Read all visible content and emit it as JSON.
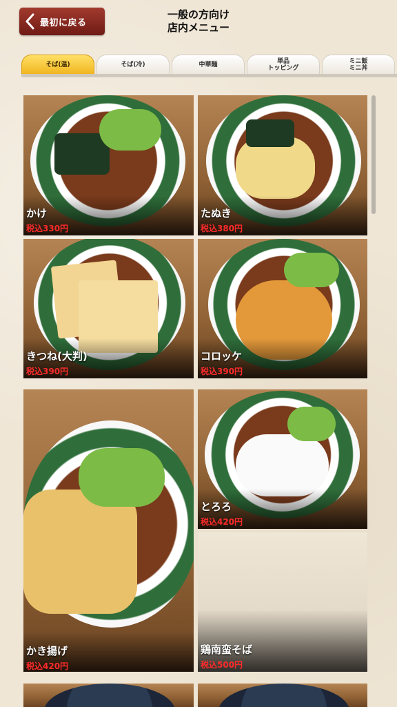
{
  "header": {
    "back_label": "最初に戻る",
    "title_line1": "一般の方向け",
    "title_line2": "店内メニュー"
  },
  "tabs": [
    {
      "label": "そば(温)",
      "active": true
    },
    {
      "label": "そば(冷)",
      "active": false
    },
    {
      "label": "中華麺",
      "active": false
    },
    {
      "label": "単品\nトッピング",
      "active": false
    },
    {
      "label": "ミニ飯\nミニ丼",
      "active": false
    }
  ],
  "menu": [
    {
      "name": "かけ",
      "price": "税込330円"
    },
    {
      "name": "たぬき",
      "price": "税込380円"
    },
    {
      "name": "きつね(大判)",
      "price": "税込390円"
    },
    {
      "name": "コロッケ",
      "price": "税込390円"
    },
    {
      "name": "かき揚げ",
      "price": "税込420円"
    },
    {
      "name": "とろろ",
      "price": "税込420円"
    },
    {
      "name": "鶏南蛮そば",
      "price": "税込500円"
    }
  ],
  "colors": {
    "active_tab": "#f0b41d",
    "back_button": "#8a241c",
    "price_text": "#ff2a2a"
  }
}
